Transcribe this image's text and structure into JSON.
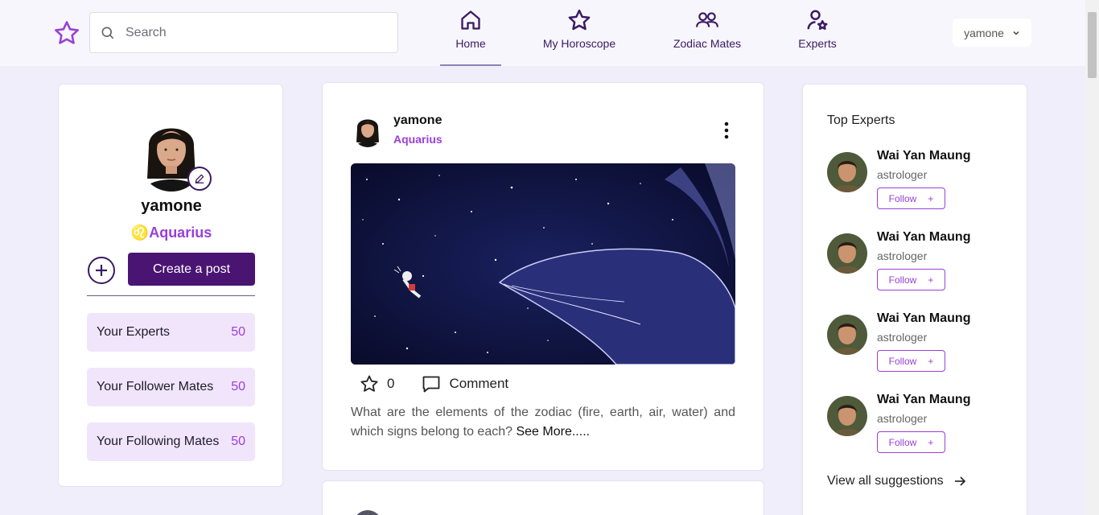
{
  "header": {
    "search": {
      "placeholder": "Search"
    },
    "nav": [
      {
        "label": "Home",
        "icon": "home-icon"
      },
      {
        "label": "My Horoscope",
        "icon": "star-icon"
      },
      {
        "label": "Zodiac Mates",
        "icon": "people-icon"
      },
      {
        "label": "Experts",
        "icon": "expert-icon"
      }
    ],
    "user_menu": {
      "label": "yamone"
    }
  },
  "profile": {
    "name": "yamone",
    "sign": "♌Aquarius",
    "create_post_label": "Create a post",
    "stats": [
      {
        "label": "Your Experts",
        "value": "50"
      },
      {
        "label": "Your Follower Mates",
        "value": "50"
      },
      {
        "label": "Your Following Mates",
        "value": "50"
      }
    ]
  },
  "post": {
    "user": "yamone",
    "sign": "Aquarius",
    "likes": "0",
    "comment_label": "Comment",
    "text": "What are the elements of the zodiac (fire, earth, air, water) and which signs belong to each?",
    "see_more": "See More....."
  },
  "top_experts": {
    "title": "Top Experts",
    "experts": [
      {
        "name": "Wai Yan Maung",
        "role": "astrologer",
        "follow_label": "Follow"
      },
      {
        "name": "Wai Yan Maung",
        "role": "astrologer",
        "follow_label": "Follow"
      },
      {
        "name": "Wai Yan Maung",
        "role": "astrologer",
        "follow_label": "Follow"
      },
      {
        "name": "Wai Yan Maung",
        "role": "astrologer",
        "follow_label": "Follow"
      }
    ],
    "view_all_label": "View all suggestions"
  },
  "colors": {
    "accent": "#9a3fd8",
    "primary": "#4a1473",
    "nav": "#3b1a63"
  }
}
